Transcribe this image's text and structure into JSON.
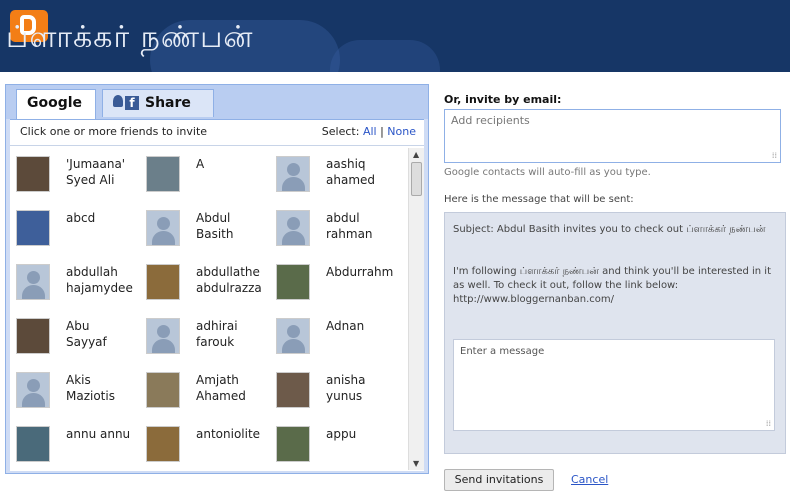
{
  "header": {
    "blog_title": "ப்ளாக்கர் நண்பன்"
  },
  "tabs": {
    "google_label": "Google",
    "share_label": "Share"
  },
  "friends_panel": {
    "instruction": "Click one or more friends to invite",
    "select_label": "Select:",
    "select_all": "All",
    "separator": "|",
    "select_none": "None"
  },
  "friends": [
    {
      "name": "'Jumaana'\nSyed Ali",
      "avatar": "photo"
    },
    {
      "name": "A",
      "avatar": "photo"
    },
    {
      "name": "aashiq\nahamed",
      "avatar": "default"
    },
    {
      "name": "abcd",
      "avatar": "photo"
    },
    {
      "name": "Abdul\nBasith",
      "avatar": "default"
    },
    {
      "name": "abdul\nrahman",
      "avatar": "default"
    },
    {
      "name": "abdullah\nhajamydee",
      "avatar": "default"
    },
    {
      "name": "abdullathe\nabdulrazza",
      "avatar": "photo"
    },
    {
      "name": "Abdurrahm",
      "avatar": "photo"
    },
    {
      "name": "Abu\nSayyaf",
      "avatar": "photo"
    },
    {
      "name": "adhirai\nfarouk",
      "avatar": "default"
    },
    {
      "name": "Adnan",
      "avatar": "default"
    },
    {
      "name": "Akis\nMaziotis",
      "avatar": "default"
    },
    {
      "name": "Amjath\nAhamed",
      "avatar": "photo"
    },
    {
      "name": "anisha\nyunus",
      "avatar": "photo"
    },
    {
      "name": "annu annu",
      "avatar": "photo"
    },
    {
      "name": "antoniolite",
      "avatar": "photo"
    },
    {
      "name": "appu",
      "avatar": "photo"
    }
  ],
  "email_invite": {
    "heading": "Or, invite by email:",
    "recipients_placeholder": "Add recipients",
    "autofill_hint": "Google contacts will auto-fill as you type.",
    "message_heading": "Here is the message that will be sent:",
    "subject": "Subject: Abdul Basith invites you to check out ப்ளாக்கர் நண்பன்",
    "body": "I'm following ப்ளாக்கர் நண்பன் and think you'll be interested in it as well. To check it out, follow the link below: http://www.bloggernanban.com/",
    "message_placeholder": "Enter a message"
  },
  "actions": {
    "send_label": "Send invitations",
    "cancel_label": "Cancel"
  },
  "icons": {
    "logo": "blogger-logo-icon",
    "facebook": "facebook-icon",
    "scroll_up": "scroll-up-arrow-icon",
    "scroll_down": "scroll-down-arrow-icon",
    "resize": "resize-grip-icon"
  },
  "colors": {
    "header_bg": "#163666",
    "logo_orange": "#f37e16",
    "panel_border": "#8fb0e6",
    "link_blue": "#2a55c7"
  }
}
